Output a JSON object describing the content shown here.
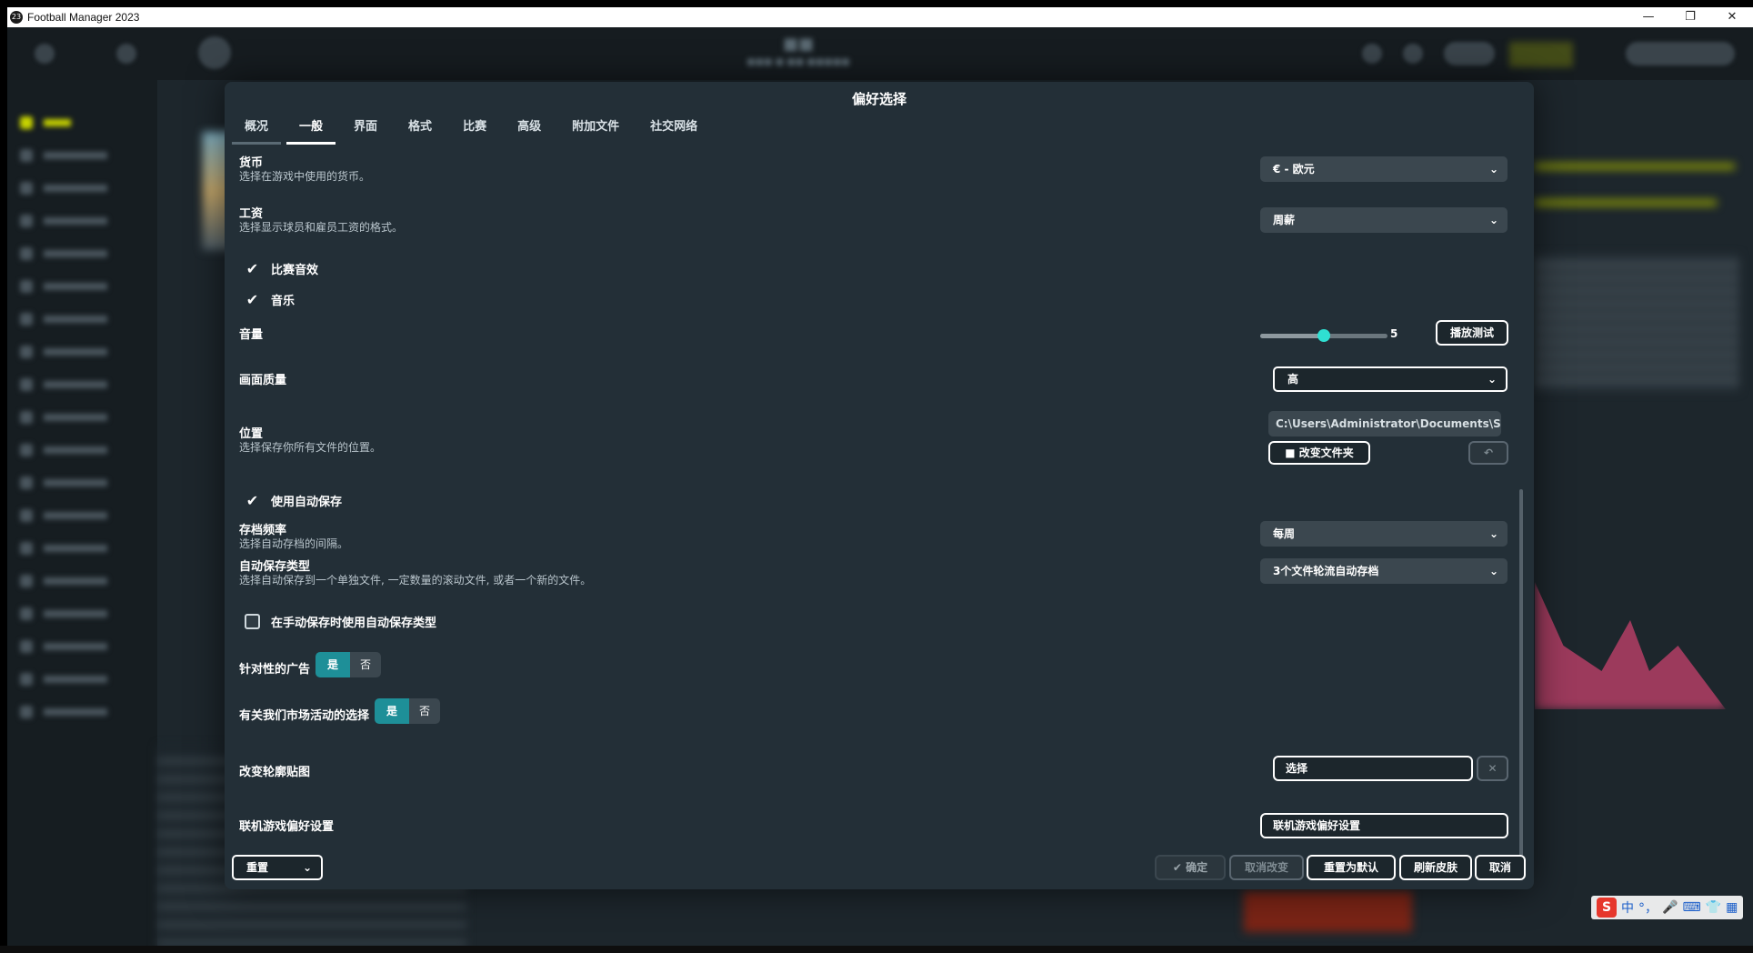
{
  "window": {
    "title": "Football Manager 2023",
    "icon_text": "23",
    "min": "—",
    "max": "❐",
    "close": "✕"
  },
  "dialog": {
    "title": "偏好选择",
    "tabs": [
      {
        "label": "概况"
      },
      {
        "label": "一般"
      },
      {
        "label": "界面"
      },
      {
        "label": "格式"
      },
      {
        "label": "比赛"
      },
      {
        "label": "高级"
      },
      {
        "label": "附加文件"
      },
      {
        "label": "社交网络"
      }
    ],
    "active_tab": "一般",
    "currency": {
      "label": "货币",
      "desc": "选择在游戏中使用的货币。",
      "value": "€ - 欧元"
    },
    "wages": {
      "label": "工资",
      "desc": "选择显示球员和雇员工资的格式。",
      "value": "周薪"
    },
    "match_sound": {
      "label": "比赛音效",
      "checked": true
    },
    "music": {
      "label": "音乐",
      "checked": true
    },
    "volume": {
      "label": "音量",
      "value": 5,
      "value_text": "5",
      "level": 0.5,
      "test_button": "播放测试"
    },
    "graphics": {
      "label": "画面质量",
      "value": "高"
    },
    "location": {
      "label": "位置",
      "desc": "选择保存你所有文件的位置。",
      "path": "C:\\Users\\Administrator\\Documents\\Spo...",
      "change_button": "改变文件夹",
      "reset_icon": "undo-icon"
    },
    "autosave": {
      "label": "使用自动保存",
      "checked": true
    },
    "save_freq": {
      "label": "存档频率",
      "desc": "选择自动存档的间隔。",
      "value": "每周"
    },
    "autosave_type": {
      "label": "自动保存类型",
      "desc": "选择自动保存到一个单独文件, 一定数量的滚动文件, 或者一个新的文件。",
      "value": "3个文件轮流自动存档"
    },
    "manual_autosave": {
      "label": "在手动保存时使用自动保存类型",
      "checked": false
    },
    "targeted_ads": {
      "label": "针对性的广告",
      "yes": "是",
      "no": "否",
      "selected": "是"
    },
    "marketing": {
      "label": "有关我们市场活动的选择",
      "yes": "是",
      "no": "否",
      "selected": "是"
    },
    "skin": {
      "label": "改变轮廓贴图",
      "button": "选择",
      "clear": "✕"
    },
    "online": {
      "label": "联机游戏偏好设置",
      "button": "联机游戏偏好设置"
    },
    "footer": {
      "reset": "重置",
      "confirm": "确定",
      "cancel_changes": "取消改变",
      "reset_default": "重置为默认",
      "refresh_skin": "刷新皮肤",
      "cancel": "取消"
    }
  },
  "ime": {
    "s": "S",
    "lang": "中",
    "punct": "°，",
    "mic": "🎤",
    "kbd": "⌨",
    "shirt": "👕",
    "grid": "▦"
  },
  "colors": {
    "accent": "#1e8f98",
    "slider_knob": "#2fe0d2",
    "dialog_bg": "#232f37",
    "app_bg": "#1d262c"
  }
}
